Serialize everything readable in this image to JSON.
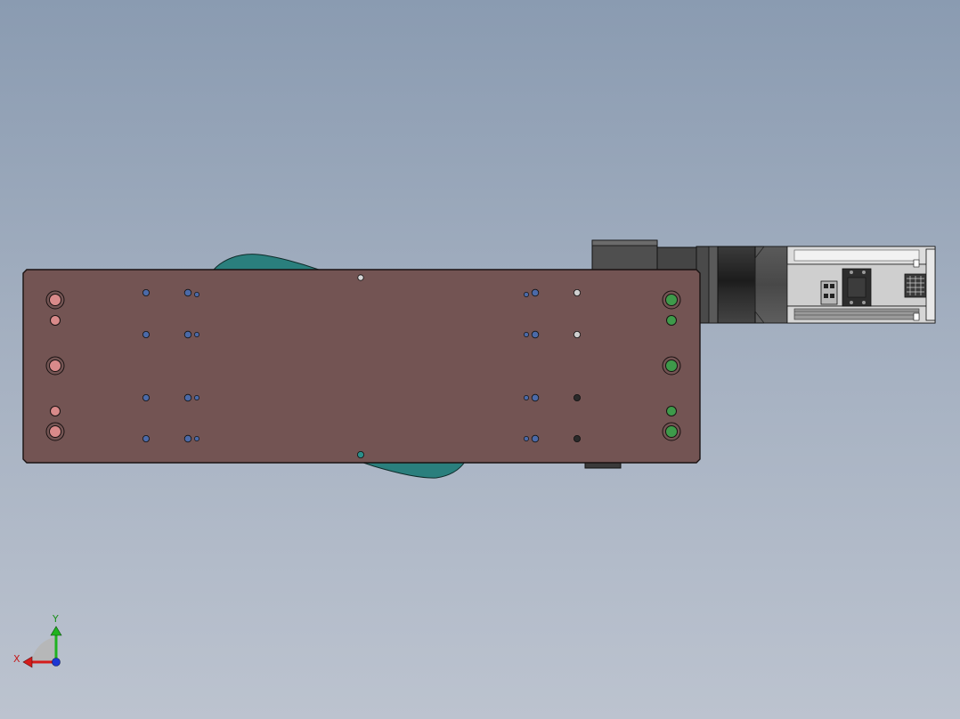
{
  "viewport": {
    "background_top": "#8a9bb1",
    "background_bottom": "#bcc3cf"
  },
  "model": {
    "plate_color": "#735453",
    "bracket_color": "#2a7f7d",
    "motor_body_color": "#4f4f4f",
    "motor_collar_color": "#2d2d2d",
    "driver_color": "#d9d9d9"
  },
  "triad": {
    "x_label": "X",
    "y_label": "Y",
    "x_color": "#d41c1c",
    "y_color": "#1fb21f",
    "z_color": "#1c37d4"
  }
}
